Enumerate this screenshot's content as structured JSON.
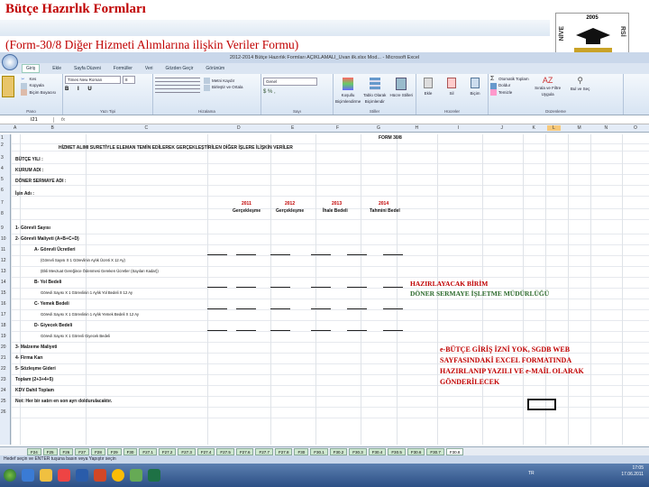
{
  "slide": {
    "title": "Bütçe Hazırlık Formları",
    "subtitle": "(Form-30/8 Diğer Hizmeti Alımlarına ilişkin Veriler Formu)",
    "logo_year": "2005",
    "logo_left": "NİVE",
    "logo_right": "RSİ"
  },
  "excel": {
    "window_title": "2012-2014 Bütçe Hazırlık Formları AÇIKLAMALI_Uvan ilk.xlsx Mod... - Microsoft Excel",
    "tabs": [
      "Giriş",
      "Ekle",
      "Sayfa Düzeni",
      "Formüller",
      "Veri",
      "Gözden Geçir",
      "Görünüm"
    ],
    "ribbon": {
      "clipboard_label": "Pano",
      "clipboard_items": [
        "Kes",
        "Kopyala",
        "Biçim Boyacısı"
      ],
      "font_label": "Yazı Tipi",
      "font_name": "Times New Roman",
      "font_size": "8",
      "align_label": "Hizalama",
      "align_items": [
        "Metni Kaydır",
        "Birleştir ve Ortala"
      ],
      "number_label": "Sayı",
      "number_format": "Genel",
      "styles_label": "Stiller",
      "styles_items": [
        "Koşullu Biçimlendirme",
        "Tablo Olarak Biçimlendir",
        "Hücre Stilleri"
      ],
      "cells_label": "Hücreler",
      "cells_items": [
        "Ekle",
        "Sil",
        "Biçim"
      ],
      "edit_label": "Düzenleme",
      "edit_items": [
        "Otomatik Toplam",
        "Doldur",
        "Temizle",
        "Sırala ve Filtre Uygula",
        "Bul ve Seç"
      ]
    },
    "name_box": "I21",
    "fx": "fx",
    "columns": [
      "A",
      "B",
      "C",
      "D",
      "E",
      "F",
      "G",
      "H",
      "I",
      "J",
      "K",
      "L",
      "M",
      "N",
      "O"
    ],
    "selected_column": "L",
    "rows": [
      "1",
      "2",
      "3",
      "4",
      "5",
      "6",
      "7",
      "8",
      "9",
      "10",
      "11",
      "12",
      "13",
      "14",
      "15",
      "16",
      "17",
      "18",
      "19",
      "20",
      "21",
      "22",
      "23",
      "24",
      "25",
      "26"
    ],
    "sheet": {
      "form_label": "FORM 30/8",
      "heading": "HİZMET ALIMI SURETİYLE ELEMAN TEMİN EDİLEREK GERÇEKLEŞTİRİLEN DİĞER İŞLERE İLİŞKİN VERİLER",
      "butce_yili": "BÜTÇE YILI :",
      "kurum_adi": "KURUM ADI :",
      "doner": "DÖNER SERMAYE ADI :",
      "isin_adi": "İşin Adı :",
      "years": [
        "2011",
        "2012",
        "2013",
        "2014"
      ],
      "year_sub": [
        "Gerçekleşme",
        "Gerçekleşme",
        "İhale Bedeli",
        "Tahmini Bedel"
      ],
      "items": [
        "1- Görevli Sayısı",
        "2- Görevli Maliyeti (A+B+C+D)",
        "A- Görevli Ücretleri",
        "(Görevli Sayısı X 1 Görevlinin Aylık Ücreti X 12 Ay)",
        "(Ekli Mevzuat Gereğince Ödenmesi Gereken Ücretler (Sayıları Kadar))",
        "B- Yol Bedeli",
        "Görevli Sayısı X 1 Görevlinin 1 Aylık Yol Bedeli X 12 Ay",
        "C- Yemek Bedeli",
        "Görevli Sayısı X 1 Görevlinin 1 Aylık Yemek Bedeli X 12 Ay",
        "D- Giyecek Bedeli",
        "Görevli Sayısı X 1 Görevli Giyecek Bedeli",
        "3- Malzeme Maliyeti",
        "4- Firma Karı",
        "5- Sözleşme Gideri",
        "Toplam (2+3+4+5)",
        "KDV Dahil Toplam",
        "Not: Her bir satırı en son ayrı doldurulacaktır."
      ],
      "note_title_1": "HAZIRLAYACAK BİRİM",
      "note_title_2": "DÖNER SERMAYE İŞLETME MÜDÜRLÜĞÜ",
      "note_body": [
        "e-BÜTÇE GİRİŞ İZNİ YOK, SGDB WEB",
        "SAYFASINDAKİ EXCEL FORMATINDA",
        "HAZIRLANIP YAZILI VE e-MAİL OLARAK",
        "GÖNDERİLECEK"
      ]
    },
    "sheet_tabs": [
      "F24",
      "F25",
      "F26",
      "F27",
      "F28",
      "F29",
      "F30",
      "F27.1",
      "F27.2",
      "F27.3",
      "F27.4",
      "F27.5",
      "F27.6",
      "F27.7",
      "F27.8",
      "F30",
      "F30.1",
      "F30.2",
      "F30.3",
      "F30.4",
      "F30.5",
      "F30.6",
      "F30.7",
      "F30.8"
    ],
    "active_tab": "F30.8",
    "status": "Hedef seçin ve ENTER tuşuna basın veya Yapıştır seçin",
    "clock_time": "17:05",
    "clock_date": "17.06.2011",
    "lang": "TR"
  }
}
